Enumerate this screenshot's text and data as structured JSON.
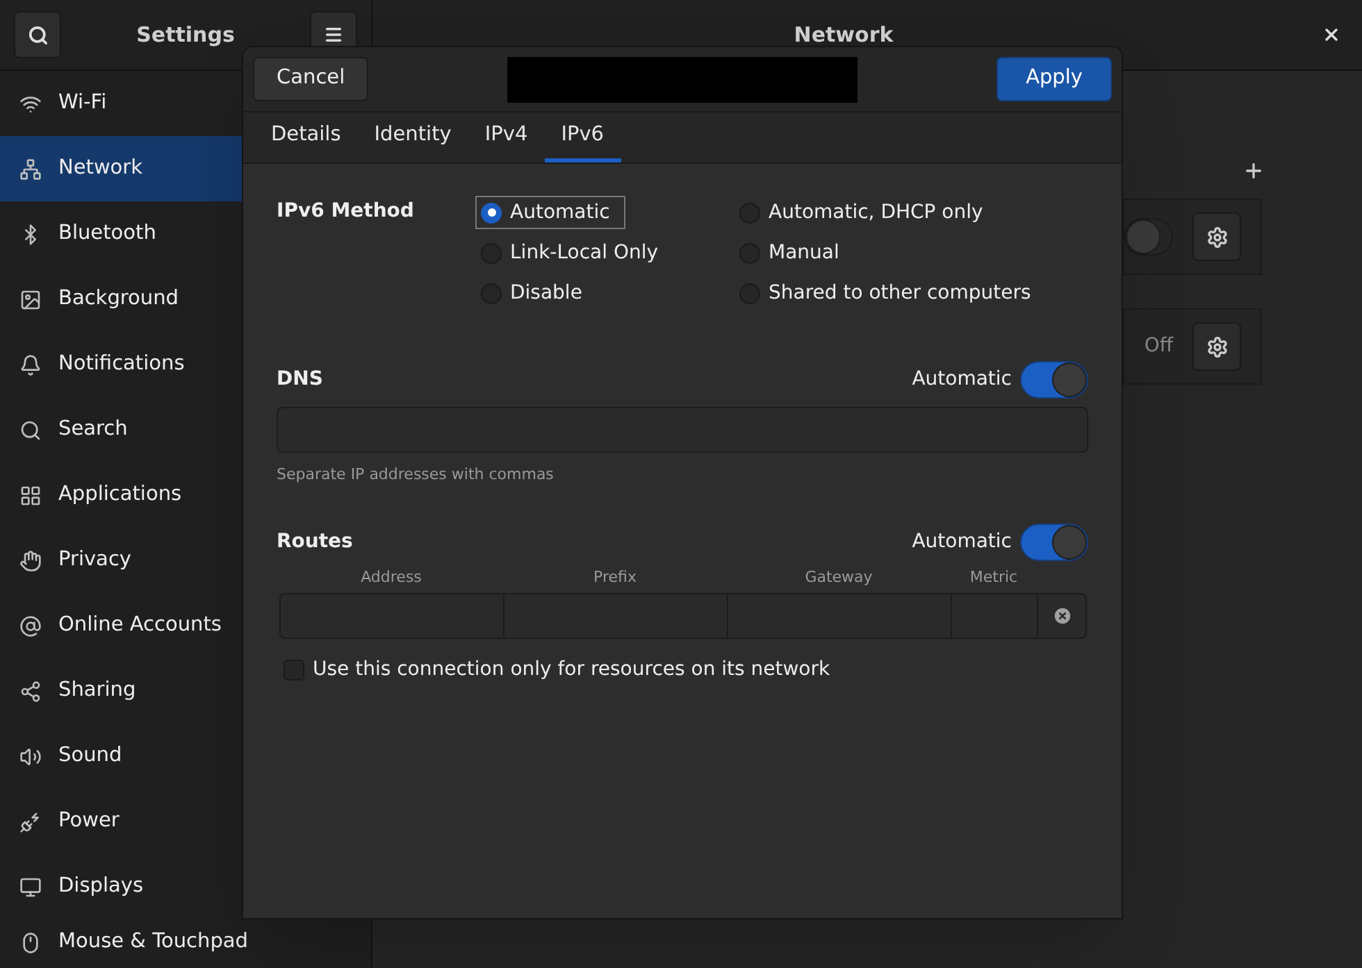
{
  "sidebar": {
    "title": "Settings",
    "items": [
      {
        "label": "Wi-Fi",
        "selected": false
      },
      {
        "label": "Network",
        "selected": true
      },
      {
        "label": "Bluetooth",
        "selected": false
      },
      {
        "label": "Background",
        "selected": false
      },
      {
        "label": "Notifications",
        "selected": false
      },
      {
        "label": "Search",
        "selected": false
      },
      {
        "label": "Applications",
        "selected": false
      },
      {
        "label": "Privacy",
        "selected": false
      },
      {
        "label": "Online Accounts",
        "selected": false
      },
      {
        "label": "Sharing",
        "selected": false
      },
      {
        "label": "Sound",
        "selected": false
      },
      {
        "label": "Power",
        "selected": false
      },
      {
        "label": "Displays",
        "selected": false
      },
      {
        "label": "Mouse & Touchpad",
        "selected": false
      }
    ]
  },
  "main": {
    "title": "Network",
    "rows": [
      {
        "kind": "switch",
        "on": false
      },
      {
        "kind": "status",
        "status": "Off"
      }
    ]
  },
  "dialog": {
    "cancel": "Cancel",
    "apply": "Apply",
    "tabs": [
      {
        "label": "Details",
        "selected": false
      },
      {
        "label": "Identity",
        "selected": false
      },
      {
        "label": "IPv4",
        "selected": false
      },
      {
        "label": "IPv6",
        "selected": true
      }
    ],
    "method": {
      "label": "IPv6 Method",
      "options": [
        {
          "label": "Automatic",
          "selected": true
        },
        {
          "label": "Automatic, DHCP only",
          "selected": false
        },
        {
          "label": "Link-Local Only",
          "selected": false
        },
        {
          "label": "Manual",
          "selected": false
        },
        {
          "label": "Disable",
          "selected": false
        },
        {
          "label": "Shared to other computers",
          "selected": false
        }
      ]
    },
    "dns": {
      "label": "DNS",
      "switch_label": "Automatic",
      "on": true,
      "hint": "Separate IP addresses with commas"
    },
    "routes": {
      "label": "Routes",
      "switch_label": "Automatic",
      "on": true,
      "columns": [
        "Address",
        "Prefix",
        "Gateway",
        "Metric"
      ]
    },
    "checkbox": {
      "label": "Use this connection only for resources on its network",
      "checked": false
    }
  }
}
